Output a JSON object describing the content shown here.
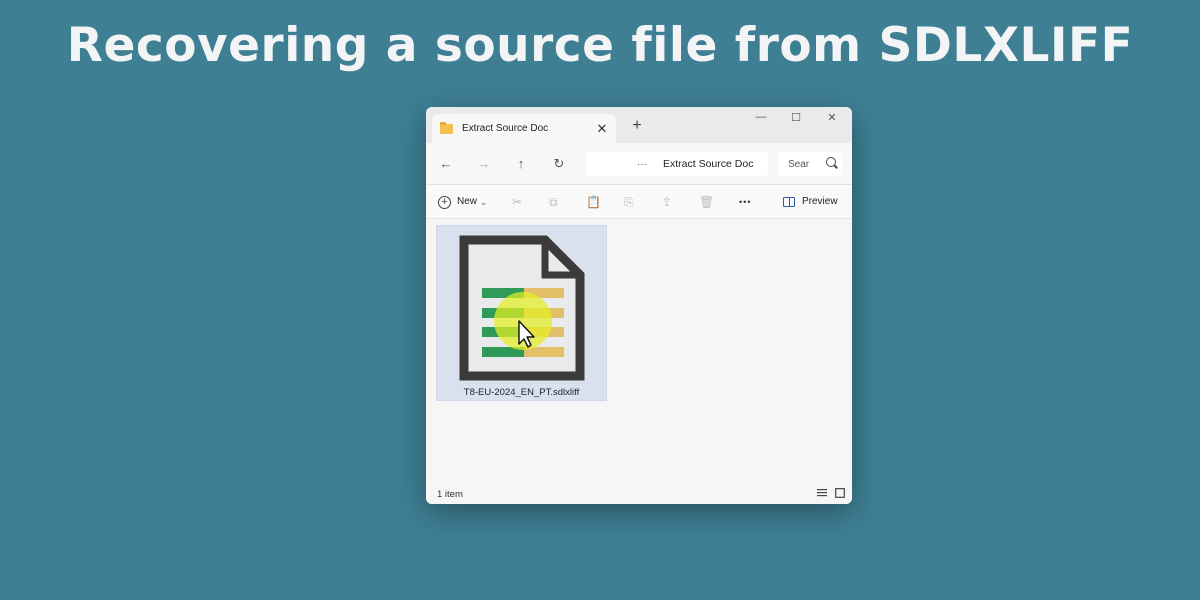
{
  "headline": "Recovering a source file from SDLXLIFF",
  "window": {
    "tab_title": "Extract Source Doc",
    "tab_close": "✕",
    "new_tab": "+",
    "controls": {
      "minimize": "—",
      "maximize": "☐",
      "close": "✕"
    },
    "nav": {
      "back": "←",
      "forward": "→",
      "up": "↑",
      "refresh": "↻"
    },
    "address": {
      "separator": "›",
      "ellipsis": "···",
      "path": "Extract Source Doc"
    },
    "search": {
      "placeholder": "Sear"
    },
    "toolbar": {
      "new_label": "New",
      "new_chevron": "⌄",
      "cut": "✂",
      "copy": "⧉",
      "paste": "📋",
      "rename": "⎘",
      "share": "⇪",
      "delete": "🗑",
      "more": "•••",
      "preview_label": "Preview"
    },
    "file": {
      "name": "T8-EU-2024_EN_PT.sdlxliff",
      "selected": true
    },
    "status": {
      "count": "1 item"
    }
  },
  "colors": {
    "background": "#3e7f94",
    "selection": "#d9e1ee",
    "highlight": "#e4ee22",
    "doc_frame": "#3b3b3b",
    "green_bar": "#2e9b58",
    "gold_bar": "#e2c06a"
  }
}
